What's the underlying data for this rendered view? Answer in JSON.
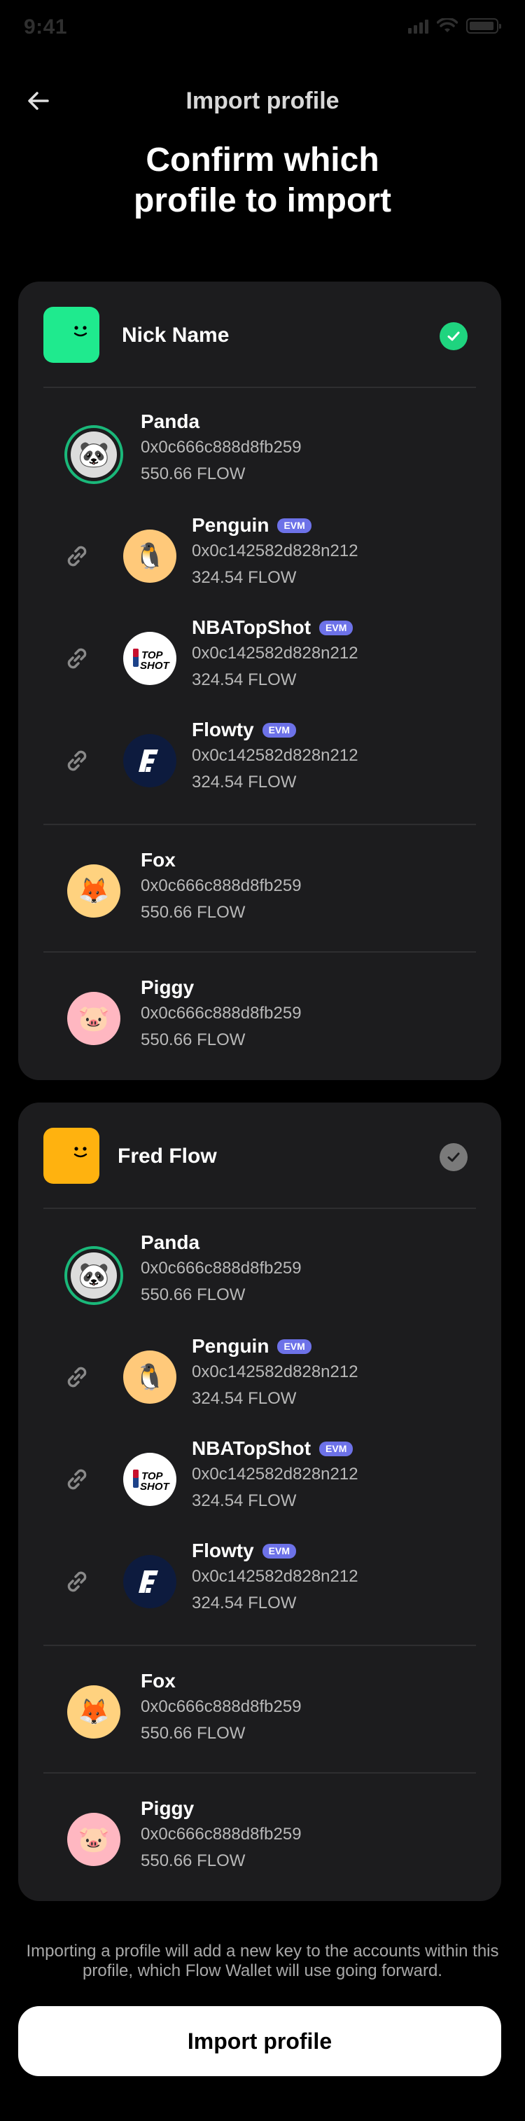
{
  "status_bar": {
    "time": "9:41"
  },
  "nav": {
    "title": "Import profile"
  },
  "headline": {
    "line1": "Confirm which",
    "line2": "profile to import"
  },
  "profiles": [
    {
      "name": "Nick Name",
      "avatar_color": "#1FEA8E",
      "selected": true,
      "check_color": "#1FD47F",
      "accounts": {
        "panda": {
          "name": "Panda",
          "address": "0x0c666c888d8fb259",
          "balance": "550.66 FLOW",
          "icon": "panda-emoji"
        },
        "penguin": {
          "name": "Penguin",
          "badge": "EVM",
          "address": "0x0c142582d828n212",
          "balance": "324.54 FLOW",
          "icon": "penguin-emoji"
        },
        "nbatopshot": {
          "name": "NBATopShot",
          "badge": "EVM",
          "address": "0x0c142582d828n212",
          "balance": "324.54 FLOW",
          "icon": "topshot-logo"
        },
        "flowty": {
          "name": "Flowty",
          "badge": "EVM",
          "address": "0x0c142582d828n212",
          "balance": "324.54 FLOW",
          "icon": "flowty-logo"
        },
        "fox": {
          "name": "Fox",
          "address": "0x0c666c888d8fb259",
          "balance": "550.66 FLOW",
          "icon": "fox-emoji"
        },
        "piggy": {
          "name": "Piggy",
          "address": "0x0c666c888d8fb259",
          "balance": "550.66 FLOW",
          "icon": "pig-emoji"
        }
      }
    },
    {
      "name": "Fred Flow",
      "avatar_color": "#FFB20F",
      "selected": false,
      "check_color": "#7A7A7A",
      "accounts": {
        "panda": {
          "name": "Panda",
          "address": "0x0c666c888d8fb259",
          "balance": "550.66 FLOW",
          "icon": "panda-emoji"
        },
        "penguin": {
          "name": "Penguin",
          "badge": "EVM",
          "address": "0x0c142582d828n212",
          "balance": "324.54 FLOW",
          "icon": "penguin-emoji"
        },
        "nbatopshot": {
          "name": "NBATopShot",
          "badge": "EVM",
          "address": "0x0c142582d828n212",
          "balance": "324.54 FLOW",
          "icon": "topshot-logo"
        },
        "flowty": {
          "name": "Flowty",
          "badge": "EVM",
          "address": "0x0c142582d828n212",
          "balance": "324.54 FLOW",
          "icon": "flowty-logo"
        },
        "fox": {
          "name": "Fox",
          "address": "0x0c666c888d8fb259",
          "balance": "550.66 FLOW",
          "icon": "fox-emoji"
        },
        "piggy": {
          "name": "Piggy",
          "address": "0x0c666c888d8fb259",
          "balance": "550.66 FLOW",
          "icon": "pig-emoji"
        }
      }
    }
  ],
  "footer": {
    "note": "Importing a profile will add a new key to the accounts within this profile, which Flow Wallet will use going forward.",
    "button_label": "Import profile"
  },
  "colors": {
    "background": "#000000",
    "card": "#1C1C1E",
    "accent": "#1FD47F",
    "evm_badge": "#6D72E8"
  }
}
